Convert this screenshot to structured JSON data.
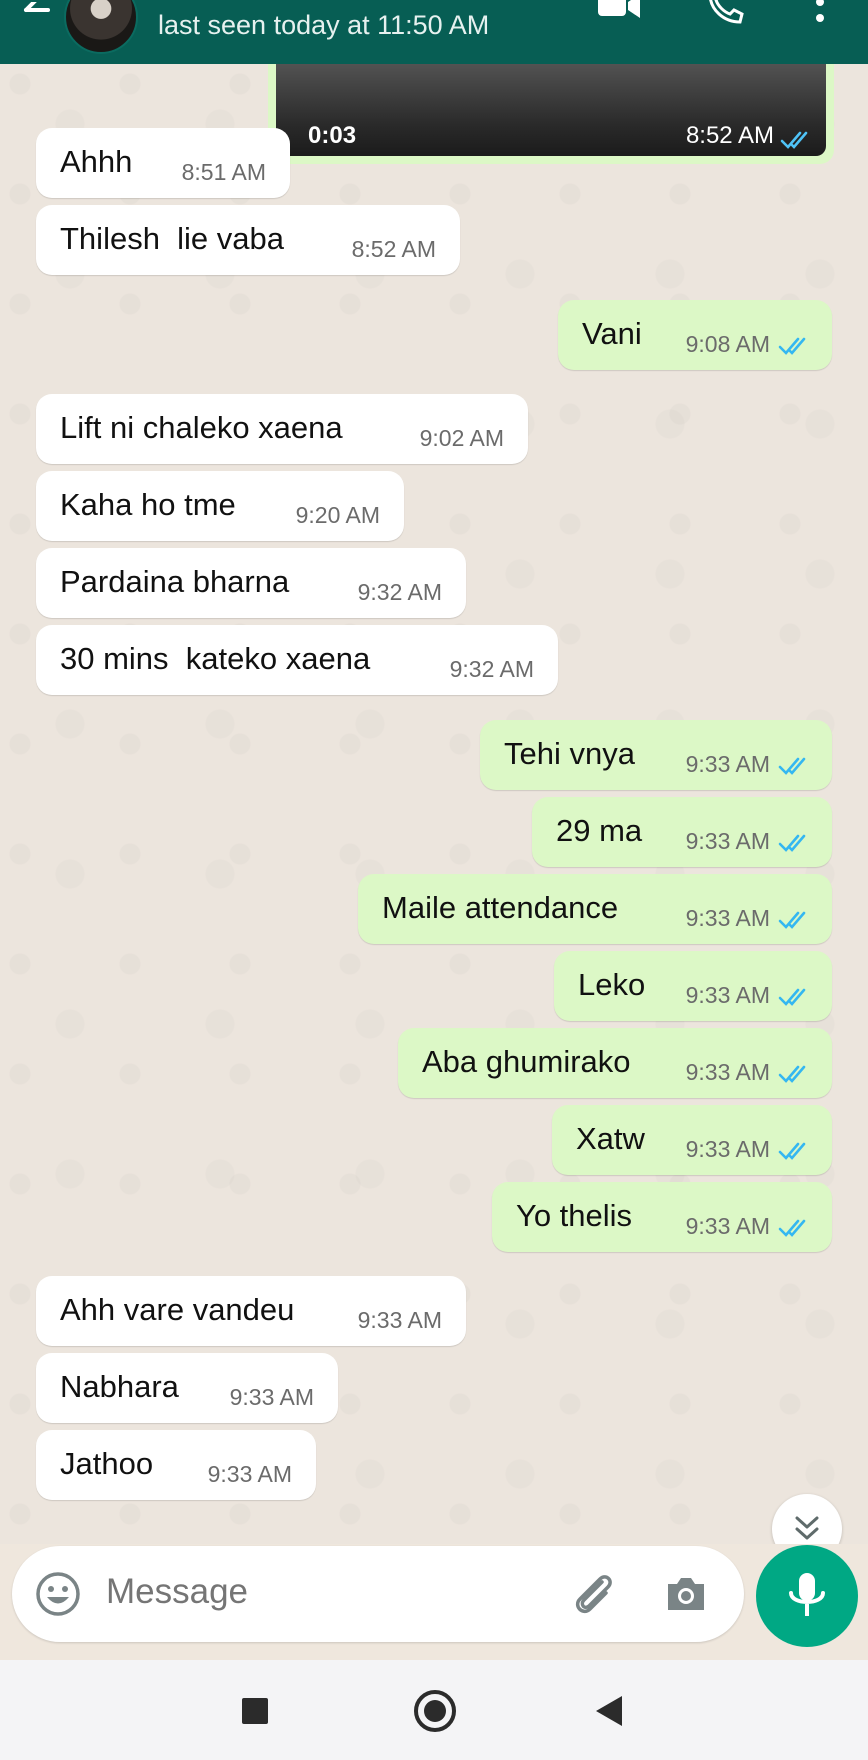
{
  "header": {
    "status": "last seen today at 11:50 AM",
    "icons": [
      "back-arrow-icon",
      "avatar",
      "video-call-icon",
      "voice-call-icon",
      "more-options-icon"
    ],
    "color": "#075e54"
  },
  "video_message": {
    "duration": "0:03",
    "time": "8:52 AM"
  },
  "messages": [
    {
      "dir": "in",
      "text": "Ahhh",
      "time": "8:51 AM"
    },
    {
      "dir": "in",
      "text": "Thilesh  lie vaba",
      "time": "8:52 AM"
    },
    {
      "dir": "out",
      "text": "Vani",
      "time": "9:08 AM"
    },
    {
      "dir": "in",
      "text": "Lift ni chaleko xaena",
      "time": "9:02 AM"
    },
    {
      "dir": "in",
      "text": "Kaha ho tme",
      "time": "9:20 AM"
    },
    {
      "dir": "in",
      "text": "Pardaina bharna",
      "time": "9:32 AM"
    },
    {
      "dir": "in",
      "text": "30 mins  kateko xaena",
      "time": "9:32 AM"
    },
    {
      "dir": "out",
      "text": "Tehi vnya",
      "time": "9:33 AM"
    },
    {
      "dir": "out",
      "text": "29 ma",
      "time": "9:33 AM"
    },
    {
      "dir": "out",
      "text": "Maile attendance",
      "time": "9:33 AM"
    },
    {
      "dir": "out",
      "text": "Leko",
      "time": "9:33 AM"
    },
    {
      "dir": "out",
      "text": "Aba ghumirako",
      "time": "9:33 AM"
    },
    {
      "dir": "out",
      "text": "Xatw",
      "time": "9:33 AM"
    },
    {
      "dir": "out",
      "text": "Yo thelis",
      "time": "9:33 AM"
    },
    {
      "dir": "in",
      "text": "Ahh vare vandeu",
      "time": "9:33 AM"
    },
    {
      "dir": "in",
      "text": "Nabhara",
      "time": "9:33 AM"
    },
    {
      "dir": "in",
      "text": "Jathoo",
      "time": "9:33 AM"
    }
  ],
  "composer": {
    "placeholder": "Message",
    "icons": [
      "emoji-icon",
      "attach-icon",
      "camera-icon",
      "mic-icon"
    ]
  },
  "colors": {
    "incoming_bubble": "#ffffff",
    "outgoing_bubble": "#dcf8c6",
    "read_tick": "#34b7f1",
    "mic_button": "#00a884"
  }
}
